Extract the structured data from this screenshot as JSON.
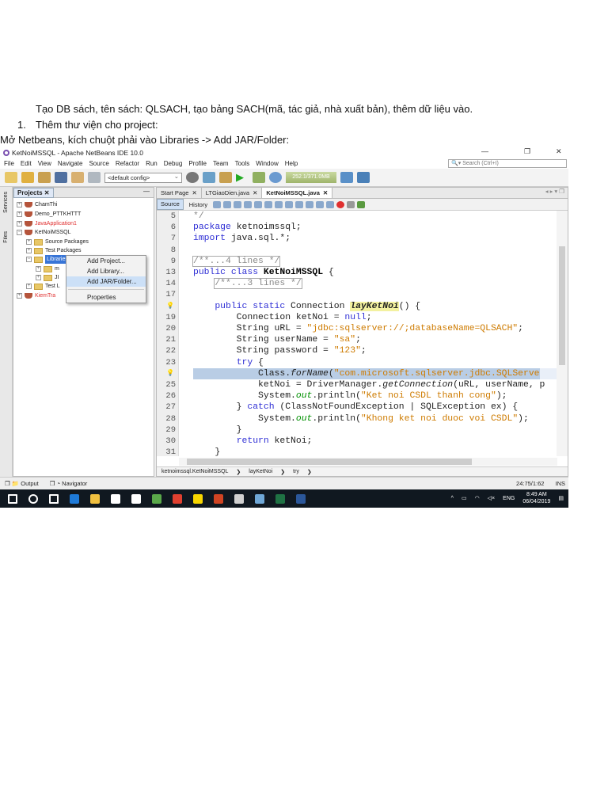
{
  "document": {
    "line1": "Tạo DB sách, tên sách: QLSACH, tạo bảng SACH(mã, tác giả, nhà xuất bản), thêm dữ liệu vào.",
    "list_number": "1.",
    "line2": "Thêm thư viện cho project:",
    "line3": "Mở Netbeans, kích chuột phải vào Libraries -> Add JAR/Folder:"
  },
  "ide": {
    "title": "KetNoiMSSQL - Apache NetBeans IDE 10.0",
    "window_controls": [
      "—",
      "❐",
      "✕"
    ],
    "menu": [
      "File",
      "Edit",
      "View",
      "Navigate",
      "Source",
      "Refactor",
      "Run",
      "Debug",
      "Profile",
      "Team",
      "Tools",
      "Window",
      "Help"
    ],
    "search_placeholder": "Search (Ctrl+I)",
    "config": "<default config>",
    "memory": "252.1/371.0MB",
    "side_tabs": [
      "Services",
      "Files"
    ],
    "projects_tab": "Projects",
    "tree": [
      {
        "label": "ChamThi",
        "red": false
      },
      {
        "label": "Demo_PTTKHTTT",
        "red": false
      },
      {
        "label": "JavaApplication1",
        "red": true
      },
      {
        "label": "KetNoiMSSQL",
        "red": false
      },
      {
        "label": "Source Packages",
        "red": false
      },
      {
        "label": "Test Packages",
        "red": false
      },
      {
        "label": "Libraries",
        "red": false
      },
      {
        "label": "m",
        "red": false
      },
      {
        "label": "JI",
        "red": false
      },
      {
        "label": "Test L",
        "red": false
      },
      {
        "label": "KiemTra",
        "red": true
      }
    ],
    "context_menu": [
      "Add Project...",
      "Add Library...",
      "Add JAR/Folder...",
      "Properties"
    ],
    "editor_tabs": [
      "Start Page",
      "LTGiaoDien.java",
      "KetNoiMSSQL.java"
    ],
    "source_tab": "Source",
    "history_tab": "History",
    "code": [
      {
        "n": "5",
        "seg": [
          [
            "*/",
            "c"
          ]
        ]
      },
      {
        "n": "6",
        "seg": [
          [
            "package",
            "k"
          ],
          [
            " ketnoimssql;",
            ""
          ]
        ]
      },
      {
        "n": "7",
        "seg": [
          [
            "import",
            "k"
          ],
          [
            " java.sql.*;",
            ""
          ]
        ]
      },
      {
        "n": "8",
        "seg": []
      },
      {
        "n": "9",
        "seg": [
          [
            "/**...4 lines */",
            "c boxc"
          ]
        ]
      },
      {
        "n": "13",
        "seg": [
          [
            "public class",
            "k"
          ],
          [
            " ",
            ""
          ],
          [
            "KetNoiMSSQL",
            "b"
          ],
          [
            " {",
            ""
          ]
        ]
      },
      {
        "n": "14",
        "seg": [
          [
            "    ",
            ""
          ],
          [
            "/**...3 lines */",
            "c boxc"
          ]
        ]
      },
      {
        "n": "17",
        "seg": []
      },
      {
        "n": "",
        "seg": [
          [
            "    ",
            ""
          ],
          [
            "public static",
            "k"
          ],
          [
            " Connection ",
            ""
          ],
          [
            "layKetNoi",
            "y"
          ],
          [
            "() {",
            ""
          ]
        ]
      },
      {
        "n": "19",
        "seg": [
          [
            "        Connection ketNoi = ",
            ""
          ],
          [
            "null",
            "k"
          ],
          [
            ";",
            ""
          ]
        ]
      },
      {
        "n": "20",
        "seg": [
          [
            "        String uRL = ",
            ""
          ],
          [
            "\"jdbc:sqlserver://;databaseName=QLSACH\"",
            "s"
          ],
          [
            ";",
            ""
          ]
        ]
      },
      {
        "n": "21",
        "seg": [
          [
            "        String userName = ",
            ""
          ],
          [
            "\"sa\"",
            "s"
          ],
          [
            ";",
            ""
          ]
        ]
      },
      {
        "n": "22",
        "seg": [
          [
            "        String password = ",
            ""
          ],
          [
            "\"123\"",
            "s"
          ],
          [
            ";",
            ""
          ]
        ]
      },
      {
        "n": "23",
        "seg": [
          [
            "        ",
            ""
          ],
          [
            "try",
            "k"
          ],
          [
            " {",
            ""
          ]
        ]
      },
      {
        "n": "",
        "hl": true,
        "seg": [
          [
            "            Class.",
            ""
          ],
          [
            "forName",
            "i"
          ],
          [
            "(",
            ""
          ],
          [
            "\"com.microsoft.sqlserver.jdbc.SQLServe",
            "s"
          ]
        ]
      },
      {
        "n": "25",
        "seg": [
          [
            "            ketNoi = DriverManager.",
            ""
          ],
          [
            "getConnection",
            "i"
          ],
          [
            "(uRL, userName, p",
            ""
          ]
        ]
      },
      {
        "n": "26",
        "seg": [
          [
            "            System.",
            ""
          ],
          [
            "out",
            "g"
          ],
          [
            ".println(",
            ""
          ],
          [
            "\"Ket noi CSDL thanh cong\"",
            "s"
          ],
          [
            ");",
            ""
          ]
        ]
      },
      {
        "n": "27",
        "seg": [
          [
            "        } ",
            ""
          ],
          [
            "catch",
            "k"
          ],
          [
            " (ClassNotFoundException | SQLException ex) {",
            ""
          ]
        ]
      },
      {
        "n": "28",
        "seg": [
          [
            "            System.",
            ""
          ],
          [
            "out",
            "g"
          ],
          [
            ".println(",
            ""
          ],
          [
            "\"Khong ket noi duoc voi CSDL\"",
            "s"
          ],
          [
            ");",
            ""
          ]
        ]
      },
      {
        "n": "29",
        "seg": [
          [
            "        }",
            ""
          ]
        ]
      },
      {
        "n": "30",
        "seg": [
          [
            "        ",
            ""
          ],
          [
            "return",
            "k"
          ],
          [
            " ketNoi;",
            ""
          ]
        ]
      },
      {
        "n": "31",
        "seg": [
          [
            "    }",
            ""
          ]
        ]
      }
    ],
    "breadcrumbs": [
      "ketnoimssql.KetNoiMSSQL",
      "layKetNoi",
      "try"
    ],
    "output_tab": "Output",
    "navigator_tab": "Navigator",
    "cursor_pos": "24:75/1:62",
    "ins_mode": "INS",
    "clock_time": "8:49 AM",
    "clock_date": "06/04/2019",
    "language": "ENG",
    "taskbar_colors": [
      "#ffffff",
      "#ffffff",
      "#ffffff",
      "#1e7ad8",
      "#f0c040",
      "#ffffff",
      "#ffffff",
      "#5aa84a",
      "#e04030",
      "#f7d600",
      "#d04423",
      "#d0d0d0",
      "#6fa7d6",
      "#1f7244",
      "#2b579a"
    ]
  }
}
